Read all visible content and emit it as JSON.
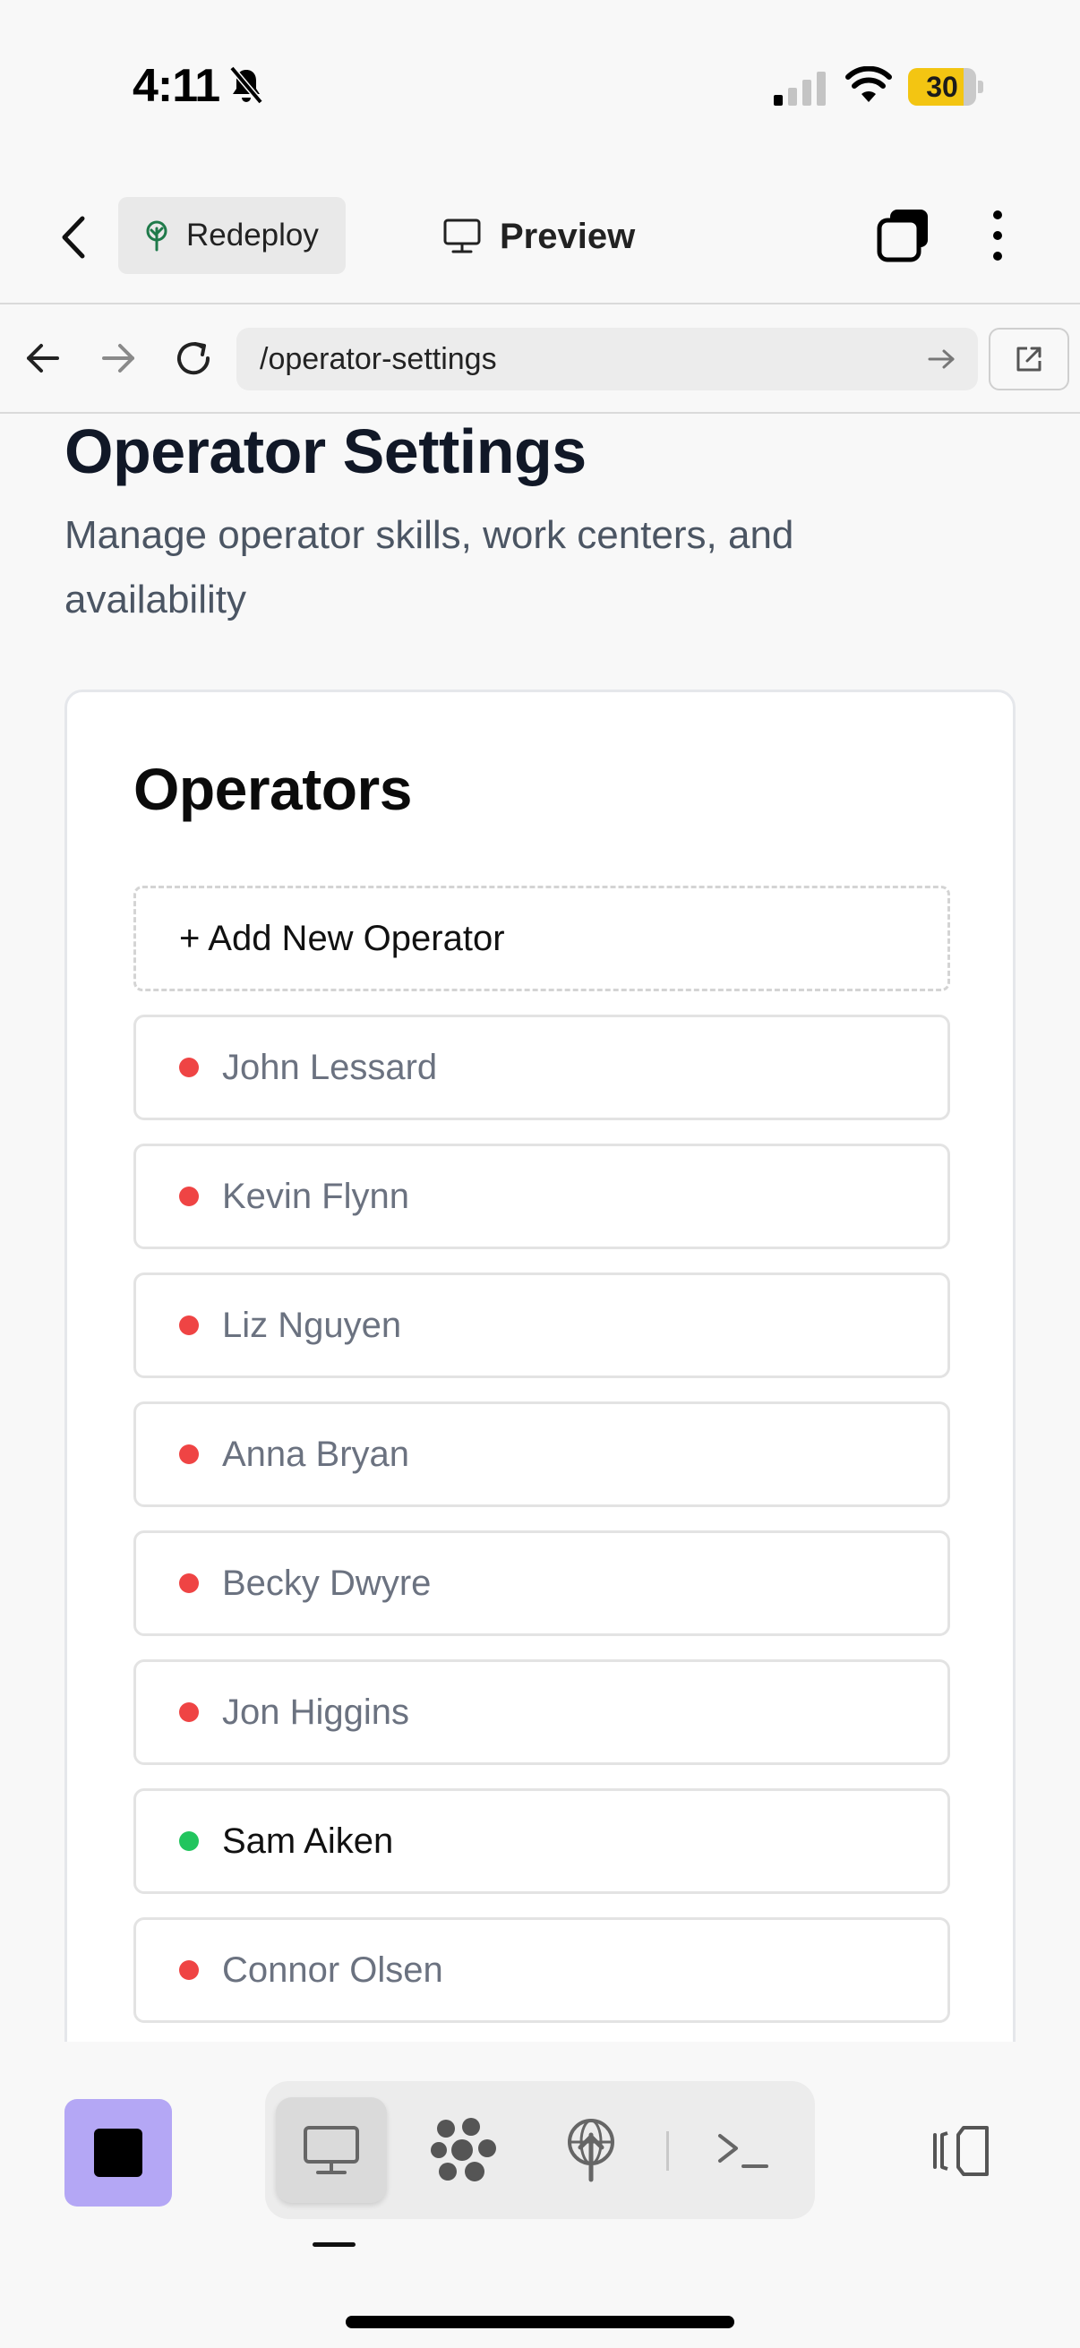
{
  "status_bar": {
    "time": "4:11",
    "battery": "30"
  },
  "toolbar": {
    "redeploy_label": "Redeploy",
    "preview_label": "Preview"
  },
  "browser": {
    "url": "/operator-settings"
  },
  "page": {
    "title": "Operator Settings",
    "subtitle": "Manage operator skills, work centers, and availability"
  },
  "operators_card": {
    "title": "Operators",
    "add_label": "+ Add New Operator",
    "items": [
      {
        "name": "John Lessard",
        "status": "unavailable"
      },
      {
        "name": "Kevin Flynn",
        "status": "unavailable"
      },
      {
        "name": "Liz Nguyen",
        "status": "unavailable"
      },
      {
        "name": "Anna Bryan",
        "status": "unavailable"
      },
      {
        "name": "Becky Dwyre",
        "status": "unavailable"
      },
      {
        "name": "Jon Higgins",
        "status": "unavailable"
      },
      {
        "name": "Sam Aiken",
        "status": "available"
      },
      {
        "name": "Connor Olsen",
        "status": "unavailable"
      }
    ]
  },
  "colors": {
    "available": "#22c55e",
    "unavailable": "#ef4444",
    "available_text": "#111111",
    "unavailable_text": "#6b7280",
    "stop_button": "#b4a7f5",
    "redeploy_icon": "#1f7a4a"
  },
  "dock": {
    "icons": [
      "preview-monitor-icon",
      "cluster-icon",
      "deploy-icon",
      "terminal-icon"
    ],
    "active": "preview-monitor-icon"
  }
}
